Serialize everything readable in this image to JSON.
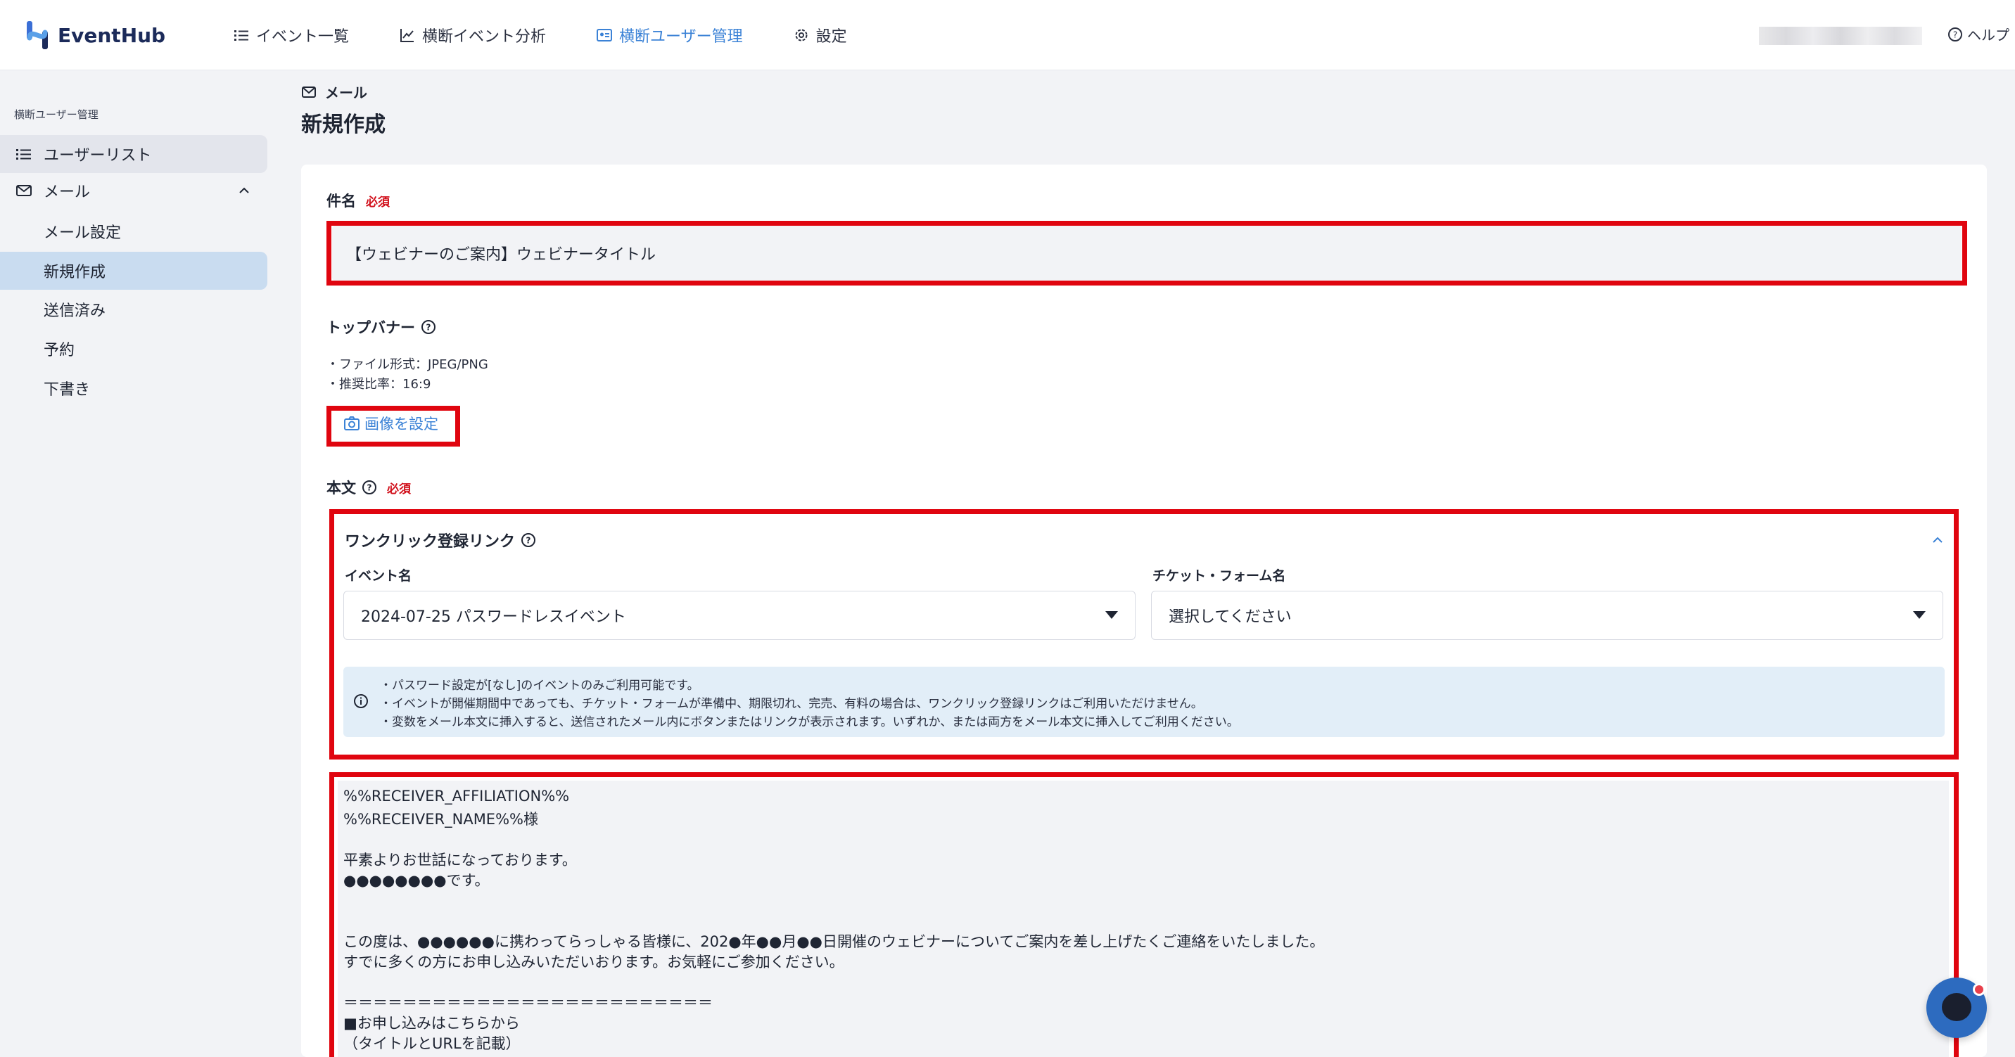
{
  "header": {
    "logo_text": "EventHub",
    "nav": [
      {
        "label": "イベント一覧",
        "icon": "list-icon",
        "active": false
      },
      {
        "label": "横断イベント分析",
        "icon": "chart-icon",
        "active": false
      },
      {
        "label": "横断ユーザー管理",
        "icon": "user-card-icon",
        "active": true
      },
      {
        "label": "設定",
        "icon": "gear-icon",
        "active": false
      }
    ],
    "help_label": "ヘルプ"
  },
  "sidebar": {
    "section_label": "横断ユーザー管理",
    "items": [
      {
        "label": "ユーザーリスト",
        "icon": "list-icon"
      },
      {
        "label": "メール",
        "icon": "mail-icon"
      },
      {
        "label": "メール設定"
      },
      {
        "label": "新規作成"
      },
      {
        "label": "送信済み"
      },
      {
        "label": "予約"
      },
      {
        "label": "下書き"
      }
    ]
  },
  "main": {
    "breadcrumb": "メール",
    "title": "新規作成",
    "subject": {
      "label": "件名",
      "required": "必須",
      "value": "【ウェビナーのご案内】ウェビナータイトル"
    },
    "banner": {
      "label": "トップバナー",
      "notes": [
        "・ファイル形式：JPEG/PNG",
        "・推奨比率：16:9"
      ],
      "button": "画像を設定"
    },
    "body": {
      "label": "本文",
      "required": "必須",
      "oneclick": {
        "title": "ワンクリック登録リンク",
        "event_label": "イベント名",
        "event_value": "2024-07-25 パスワードレスイベント",
        "ticket_label": "チケット・フォーム名",
        "ticket_value": "選択してください",
        "info": [
          "・パスワード設定が[なし]のイベントのみご利用可能です。",
          "・イベントが開催期間中であっても、チケット・フォームが準備中、期限切れ、完売、有料の場合は、ワンクリック登録リンクはご利用いただけません。",
          "・変数をメール本文に挿入すると、送信されたメール内にボタンまたはリンクが表示されます。いずれか、または両方をメール本文に挿入してご利用ください。"
        ]
      },
      "text_lines": [
        "%%RECEIVER_AFFILIATION%%",
        "%%RECEIVER_NAME%%様",
        "",
        "平素よりお世話になっております。",
        "●●●●●●●●です。",
        "",
        "",
        "この度は、●●●●●●に携わってらっしゃる皆様に、202●年●●月●●日開催のウェビナーについてご案内を差し上げたくご連絡をいたしました。",
        "すでに多くの方にお申し込みいただいおります。お気軽にご参加ください。",
        "",
        "＝＝＝＝＝＝＝＝＝＝＝＝＝＝＝＝＝＝＝＝＝＝＝＝＝",
        "■お申し込みはこちらから",
        "（タイトルとURLを記載）"
      ]
    }
  },
  "colors": {
    "accent": "#3b82d6",
    "highlight": "#e0050f",
    "required": "#d10f1a"
  }
}
